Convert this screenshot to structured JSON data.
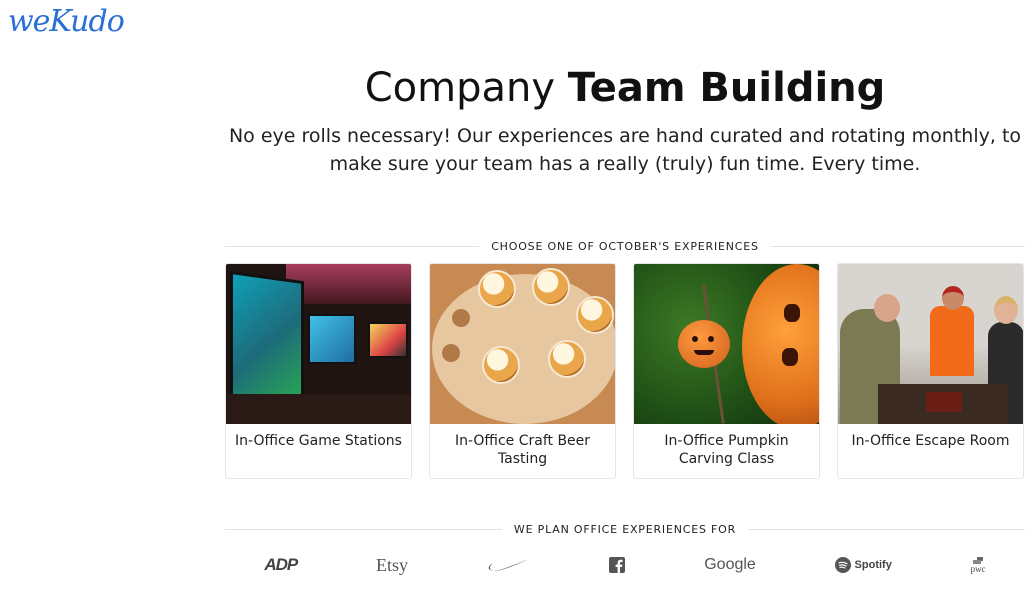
{
  "brand": {
    "logo_text": "weKudo"
  },
  "hero": {
    "title_light": "Company ",
    "title_bold": "Team Building",
    "subtitle": "No eye rolls necessary! Our experiences are hand curated and rotating monthly, to make sure your team has a really (truly) fun time. Every time."
  },
  "experiences": {
    "heading": "CHOOSE ONE OF OCTOBER'S EXPERIENCES",
    "cards": [
      {
        "title": "In-Office Game Stations",
        "image": "game-stations-photo"
      },
      {
        "title": "In-Office Craft Beer Tasting",
        "image": "beer-flight-photo"
      },
      {
        "title": "In-Office Pumpkin Carving Class",
        "image": "pumpkin-photo"
      },
      {
        "title": "In-Office Escape Room",
        "image": "escape-room-photo"
      }
    ]
  },
  "clients": {
    "heading": "WE PLAN OFFICE EXPERIENCES FOR",
    "logos": [
      {
        "name": "ADP",
        "label": "ADP"
      },
      {
        "name": "Etsy",
        "label": "Etsy"
      },
      {
        "name": "Nike",
        "label": ""
      },
      {
        "name": "Facebook",
        "label": ""
      },
      {
        "name": "Google",
        "label": "Google"
      },
      {
        "name": "Spotify",
        "label": "Spotify"
      },
      {
        "name": "PwC",
        "label": "pwc"
      }
    ]
  },
  "colors": {
    "logo": "#2b6fd6",
    "text": "#222222",
    "divider": "#e2e2e2"
  }
}
